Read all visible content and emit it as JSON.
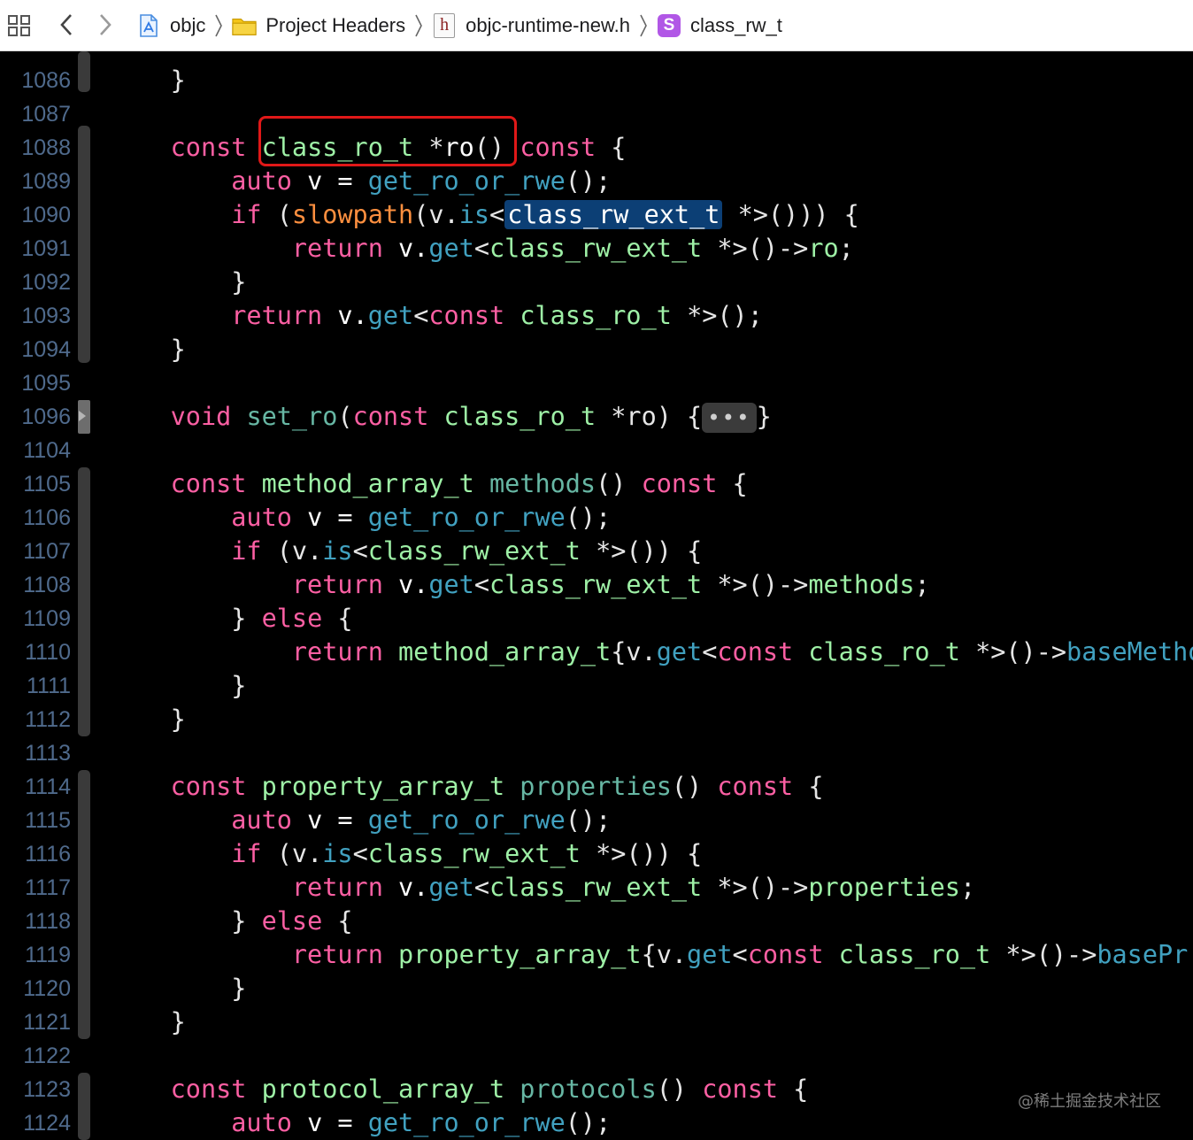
{
  "breadcrumb": {
    "items": [
      {
        "label": "objc",
        "icon": "xcode-project-icon"
      },
      {
        "label": "Project Headers",
        "icon": "folder-icon"
      },
      {
        "label": "objc-runtime-new.h",
        "icon": "header-file-icon"
      },
      {
        "label": "class_rw_t",
        "icon": "struct-symbol-icon"
      }
    ],
    "header_icon_glyph": "h",
    "struct_icon_glyph": "S"
  },
  "gutter": {
    "line_numbers": [
      "1086",
      "1087",
      "1088",
      "1089",
      "1090",
      "1091",
      "1092",
      "1093",
      "1094",
      "1095",
      "1096",
      "1104",
      "1105",
      "1106",
      "1107",
      "1108",
      "1109",
      "1110",
      "1111",
      "1112",
      "1113",
      "1114",
      "1115",
      "1116",
      "1117",
      "1118",
      "1119",
      "1120",
      "1121",
      "1122",
      "1123",
      "1124"
    ]
  },
  "code": {
    "lines": [
      [
        {
          "t": "    }",
          "c": "pun"
        }
      ],
      [],
      [
        {
          "t": "    const ",
          "c": "kw"
        },
        {
          "t": "class_ro_t ",
          "c": "gr"
        },
        {
          "t": "*",
          "c": "pun"
        },
        {
          "t": "ro",
          "c": "pl"
        },
        {
          "t": "() ",
          "c": "pun"
        },
        {
          "t": "const ",
          "c": "kw"
        },
        {
          "t": "{",
          "c": "pun"
        }
      ],
      [
        {
          "t": "        auto ",
          "c": "kw"
        },
        {
          "t": "v = ",
          "c": "pl"
        },
        {
          "t": "get_ro_or_rwe",
          "c": "mem"
        },
        {
          "t": "();",
          "c": "pun"
        }
      ],
      [
        {
          "t": "        if ",
          "c": "kw"
        },
        {
          "t": "(",
          "c": "pun"
        },
        {
          "t": "slowpath",
          "c": "fq"
        },
        {
          "t": "(v.",
          "c": "pun"
        },
        {
          "t": "is",
          "c": "mem"
        },
        {
          "t": "<",
          "c": "pun"
        },
        {
          "t": "class_rw_ext_t",
          "c": "sel"
        },
        {
          "t": " *>())) {",
          "c": "pun"
        }
      ],
      [
        {
          "t": "            return ",
          "c": "kw"
        },
        {
          "t": "v.",
          "c": "pl"
        },
        {
          "t": "get",
          "c": "mem"
        },
        {
          "t": "<",
          "c": "pun"
        },
        {
          "t": "class_rw_ext_t ",
          "c": "gr"
        },
        {
          "t": "*>()->",
          "c": "pun"
        },
        {
          "t": "ro",
          "c": "gr"
        },
        {
          "t": ";",
          "c": "pun"
        }
      ],
      [
        {
          "t": "        }",
          "c": "pun"
        }
      ],
      [
        {
          "t": "        return ",
          "c": "kw"
        },
        {
          "t": "v.",
          "c": "pl"
        },
        {
          "t": "get",
          "c": "mem"
        },
        {
          "t": "<",
          "c": "pun"
        },
        {
          "t": "const ",
          "c": "kw"
        },
        {
          "t": "class_ro_t ",
          "c": "gr"
        },
        {
          "t": "*>();",
          "c": "pun"
        }
      ],
      [
        {
          "t": "    }",
          "c": "pun"
        }
      ],
      [],
      [
        {
          "t": "    void ",
          "c": "kw"
        },
        {
          "t": "set_ro",
          "c": "fn"
        },
        {
          "t": "(",
          "c": "pun"
        },
        {
          "t": "const ",
          "c": "kw"
        },
        {
          "t": "class_ro_t ",
          "c": "gr"
        },
        {
          "t": "*ro) {",
          "c": "pun"
        },
        {
          "t": "•••",
          "c": "fold"
        },
        {
          "t": "}",
          "c": "pun"
        }
      ],
      [],
      [
        {
          "t": "    const ",
          "c": "kw"
        },
        {
          "t": "method_array_t ",
          "c": "gr"
        },
        {
          "t": "methods",
          "c": "fn"
        },
        {
          "t": "() ",
          "c": "pun"
        },
        {
          "t": "const ",
          "c": "kw"
        },
        {
          "t": "{",
          "c": "pun"
        }
      ],
      [
        {
          "t": "        auto ",
          "c": "kw"
        },
        {
          "t": "v = ",
          "c": "pl"
        },
        {
          "t": "get_ro_or_rwe",
          "c": "mem"
        },
        {
          "t": "();",
          "c": "pun"
        }
      ],
      [
        {
          "t": "        if ",
          "c": "kw"
        },
        {
          "t": "(v.",
          "c": "pun"
        },
        {
          "t": "is",
          "c": "mem"
        },
        {
          "t": "<",
          "c": "pun"
        },
        {
          "t": "class_rw_ext_t ",
          "c": "gr"
        },
        {
          "t": "*>()) {",
          "c": "pun"
        }
      ],
      [
        {
          "t": "            return ",
          "c": "kw"
        },
        {
          "t": "v.",
          "c": "pl"
        },
        {
          "t": "get",
          "c": "mem"
        },
        {
          "t": "<",
          "c": "pun"
        },
        {
          "t": "class_rw_ext_t ",
          "c": "gr"
        },
        {
          "t": "*>()->",
          "c": "pun"
        },
        {
          "t": "methods",
          "c": "gr"
        },
        {
          "t": ";",
          "c": "pun"
        }
      ],
      [
        {
          "t": "        } ",
          "c": "pun"
        },
        {
          "t": "else ",
          "c": "kw"
        },
        {
          "t": "{",
          "c": "pun"
        }
      ],
      [
        {
          "t": "            return ",
          "c": "kw"
        },
        {
          "t": "method_array_t",
          "c": "gr"
        },
        {
          "t": "{v.",
          "c": "pun"
        },
        {
          "t": "get",
          "c": "mem"
        },
        {
          "t": "<",
          "c": "pun"
        },
        {
          "t": "const ",
          "c": "kw"
        },
        {
          "t": "class_ro_t ",
          "c": "gr"
        },
        {
          "t": "*>()->",
          "c": "pun"
        },
        {
          "t": "baseMethods",
          "c": "mem"
        }
      ],
      [
        {
          "t": "        }",
          "c": "pun"
        }
      ],
      [
        {
          "t": "    }",
          "c": "pun"
        }
      ],
      [],
      [
        {
          "t": "    const ",
          "c": "kw"
        },
        {
          "t": "property_array_t ",
          "c": "gr"
        },
        {
          "t": "properties",
          "c": "fn"
        },
        {
          "t": "() ",
          "c": "pun"
        },
        {
          "t": "const ",
          "c": "kw"
        },
        {
          "t": "{",
          "c": "pun"
        }
      ],
      [
        {
          "t": "        auto ",
          "c": "kw"
        },
        {
          "t": "v = ",
          "c": "pl"
        },
        {
          "t": "get_ro_or_rwe",
          "c": "mem"
        },
        {
          "t": "();",
          "c": "pun"
        }
      ],
      [
        {
          "t": "        if ",
          "c": "kw"
        },
        {
          "t": "(v.",
          "c": "pun"
        },
        {
          "t": "is",
          "c": "mem"
        },
        {
          "t": "<",
          "c": "pun"
        },
        {
          "t": "class_rw_ext_t ",
          "c": "gr"
        },
        {
          "t": "*>()) {",
          "c": "pun"
        }
      ],
      [
        {
          "t": "            return ",
          "c": "kw"
        },
        {
          "t": "v.",
          "c": "pl"
        },
        {
          "t": "get",
          "c": "mem"
        },
        {
          "t": "<",
          "c": "pun"
        },
        {
          "t": "class_rw_ext_t ",
          "c": "gr"
        },
        {
          "t": "*>()->",
          "c": "pun"
        },
        {
          "t": "properties",
          "c": "gr"
        },
        {
          "t": ";",
          "c": "pun"
        }
      ],
      [
        {
          "t": "        } ",
          "c": "pun"
        },
        {
          "t": "else ",
          "c": "kw"
        },
        {
          "t": "{",
          "c": "pun"
        }
      ],
      [
        {
          "t": "            return ",
          "c": "kw"
        },
        {
          "t": "property_array_t",
          "c": "gr"
        },
        {
          "t": "{v.",
          "c": "pun"
        },
        {
          "t": "get",
          "c": "mem"
        },
        {
          "t": "<",
          "c": "pun"
        },
        {
          "t": "const ",
          "c": "kw"
        },
        {
          "t": "class_ro_t ",
          "c": "gr"
        },
        {
          "t": "*>()->",
          "c": "pun"
        },
        {
          "t": "basePr",
          "c": "mem"
        }
      ],
      [
        {
          "t": "        }",
          "c": "pun"
        }
      ],
      [
        {
          "t": "    }",
          "c": "pun"
        }
      ],
      [],
      [
        {
          "t": "    const ",
          "c": "kw"
        },
        {
          "t": "protocol_array_t ",
          "c": "gr"
        },
        {
          "t": "protocols",
          "c": "fn"
        },
        {
          "t": "() ",
          "c": "pun"
        },
        {
          "t": "const ",
          "c": "kw"
        },
        {
          "t": "{",
          "c": "pun"
        }
      ],
      [
        {
          "t": "        auto ",
          "c": "kw"
        },
        {
          "t": "v = ",
          "c": "pl"
        },
        {
          "t": "get_ro_or_rwe",
          "c": "mem"
        },
        {
          "t": "();",
          "c": "pun"
        }
      ]
    ]
  },
  "annotation": {
    "highlighted_text": "class_ro_t *ro()",
    "color": "#e01818"
  },
  "watermark": "@稀土掘金技术社区",
  "colors": {
    "keyword": "#fc5fa3",
    "type": "#9ef0a6",
    "function_decl": "#67b7a4",
    "member": "#41a1c0",
    "macro": "#fd8f3f",
    "line_number": "#4f6a8c",
    "selection": "#0c3f75",
    "background": "#000000"
  }
}
